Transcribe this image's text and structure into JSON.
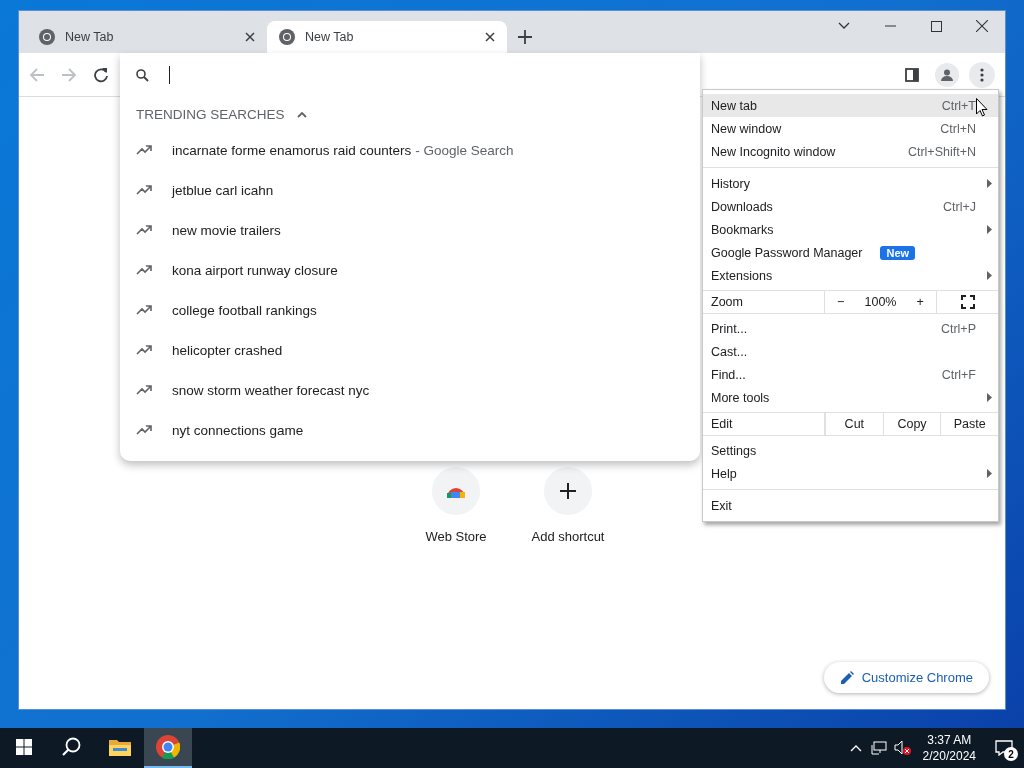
{
  "tabs": [
    {
      "title": "New Tab",
      "selected": false
    },
    {
      "title": "New Tab",
      "selected": true
    }
  ],
  "omnibox": {
    "focused": true
  },
  "suggestions": {
    "heading": "TRENDING SEARCHES",
    "expanded": true,
    "items": [
      {
        "text": "incarnate forme enamorus raid counters",
        "detail": "- Google Search"
      },
      {
        "text": "jetblue carl icahn"
      },
      {
        "text": "new movie trailers"
      },
      {
        "text": "kona airport runway closure"
      },
      {
        "text": "college football rankings"
      },
      {
        "text": "helicopter crashed"
      },
      {
        "text": "snow storm weather forecast nyc"
      },
      {
        "text": "nyt connections game"
      }
    ]
  },
  "menu": {
    "items": [
      {
        "kind": "item",
        "label": "New tab",
        "shortcut": "Ctrl+T",
        "submenu": false,
        "selected": true
      },
      {
        "kind": "item",
        "label": "New window",
        "shortcut": "Ctrl+N",
        "submenu": false,
        "selected": false
      },
      {
        "kind": "item",
        "label": "New Incognito window",
        "shortcut": "Ctrl+Shift+N",
        "submenu": false,
        "selected": false
      },
      {
        "kind": "separator"
      },
      {
        "kind": "item",
        "label": "History",
        "submenu": true,
        "selected": false
      },
      {
        "kind": "item",
        "label": "Downloads",
        "shortcut": "Ctrl+J",
        "submenu": false,
        "selected": false
      },
      {
        "kind": "item",
        "label": "Bookmarks",
        "submenu": true,
        "selected": false
      },
      {
        "kind": "item",
        "label": "Google Password Manager",
        "badge": "New",
        "submenu": false,
        "selected": false
      },
      {
        "kind": "item",
        "label": "Extensions",
        "submenu": true,
        "selected": false
      },
      {
        "kind": "zoom",
        "label": "Zoom",
        "minus": "−",
        "value": "100%",
        "plus": "+"
      },
      {
        "kind": "item",
        "label": "Print...",
        "shortcut": "Ctrl+P",
        "submenu": false,
        "selected": false
      },
      {
        "kind": "item",
        "label": "Cast...",
        "submenu": false,
        "selected": false
      },
      {
        "kind": "item",
        "label": "Find...",
        "shortcut": "Ctrl+F",
        "submenu": false,
        "selected": false
      },
      {
        "kind": "item",
        "label": "More tools",
        "submenu": true,
        "selected": false
      },
      {
        "kind": "edit",
        "label": "Edit",
        "actions": [
          "Cut",
          "Copy",
          "Paste"
        ]
      },
      {
        "kind": "item",
        "label": "Settings",
        "submenu": false,
        "selected": false
      },
      {
        "kind": "item",
        "label": "Help",
        "submenu": true,
        "selected": false
      },
      {
        "kind": "separator"
      },
      {
        "kind": "item",
        "label": "Exit",
        "submenu": false,
        "selected": false
      }
    ]
  },
  "shortcuts": [
    {
      "kind": "store",
      "label": "Web Store"
    },
    {
      "kind": "add",
      "label": "Add shortcut"
    }
  ],
  "customize_button": "Customize Chrome",
  "taskbar": {
    "apps": [
      {
        "kind": "files",
        "selected": false
      },
      {
        "kind": "chrome",
        "selected": true
      }
    ],
    "time": "3:37 AM",
    "date": "2/20/2024",
    "notifications": "2"
  }
}
